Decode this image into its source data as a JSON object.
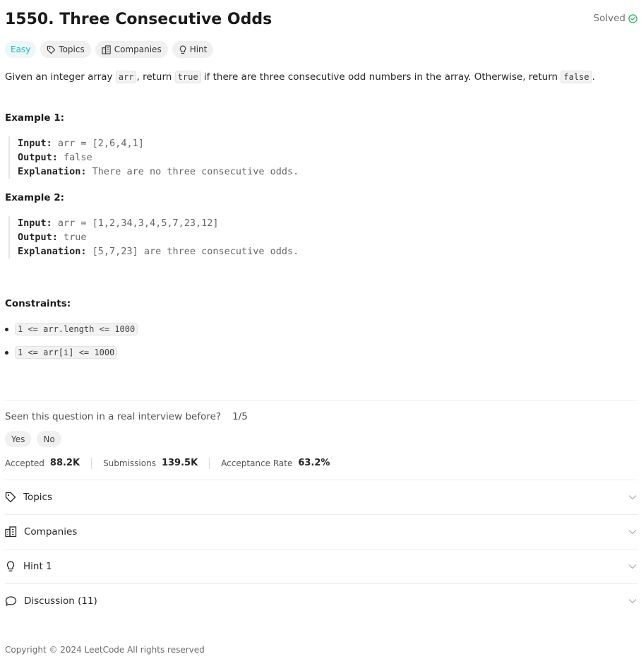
{
  "problem": {
    "title": "1550. Three Consecutive Odds",
    "status": "Solved",
    "difficulty": "Easy",
    "tags": [
      "Topics",
      "Companies",
      "Hint"
    ]
  },
  "description": {
    "part1": "Given an integer array ",
    "code1": "arr",
    "part2": ", return ",
    "code2": "true",
    "part3": " if there are three consecutive odd numbers in the array. Otherwise, return ",
    "code3": "false",
    "part4": "."
  },
  "examples": [
    {
      "heading": "Example 1:",
      "input_label": "Input:",
      "input": " arr = [2,6,4,1]",
      "output_label": "Output:",
      "output": " false",
      "explanation_label": "Explanation:",
      "explanation": " There are no three consecutive odds."
    },
    {
      "heading": "Example 2:",
      "input_label": "Input:",
      "input": " arr = [1,2,34,3,4,5,7,23,12]",
      "output_label": "Output:",
      "output": " true",
      "explanation_label": "Explanation:",
      "explanation": " [5,7,23] are three consecutive odds."
    }
  ],
  "constraints": {
    "heading": "Constraints:",
    "items": [
      "1 <= arr.length <= 1000",
      "1 <= arr[i] <= 1000"
    ]
  },
  "interview": {
    "question": "Seen this question in a real interview before?",
    "ratio": "1/5",
    "yes": "Yes",
    "no": "No"
  },
  "stats": {
    "accepted_label": "Accepted",
    "accepted": "88.2K",
    "submissions_label": "Submissions",
    "submissions": "139.5K",
    "rate_label": "Acceptance Rate",
    "rate": "63.2%"
  },
  "sections": [
    {
      "label": "Topics",
      "icon": "tag-icon"
    },
    {
      "label": "Companies",
      "icon": "building-icon"
    },
    {
      "label": "Hint 1",
      "icon": "lightbulb-icon"
    },
    {
      "label": "Discussion (11)",
      "icon": "chat-bubble-icon"
    }
  ],
  "footer": "Copyright © 2024 LeetCode All rights reserved",
  "colors": {
    "easy": "#1cb8b8",
    "solved_check": "#2db55d"
  }
}
